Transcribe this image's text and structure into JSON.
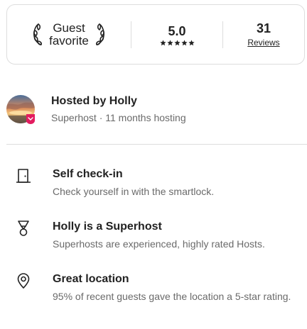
{
  "highlights": {
    "badge": {
      "line1": "Guest",
      "line2": "favorite",
      "icon": "laurel-icon"
    },
    "rating": {
      "value": "5.0",
      "stars": 5,
      "star_icon": "star-icon"
    },
    "reviews": {
      "count": "31",
      "label": "Reviews"
    }
  },
  "host": {
    "title": "Hosted by Holly",
    "subtitle": "Superhost · 11 months hosting",
    "avatar": "host-avatar",
    "badge_color": "#e31c5f"
  },
  "features": [
    {
      "icon": "door-icon",
      "title": "Self check-in",
      "subtitle": "Check yourself in with the smartlock."
    },
    {
      "icon": "medal-icon",
      "title": "Holly is a Superhost",
      "subtitle": "Superhosts are experienced, highly rated Hosts."
    },
    {
      "icon": "location-pin-icon",
      "title": "Great location",
      "subtitle": "95% of recent guests gave the location a 5-star rating."
    }
  ],
  "colors": {
    "text": "#222222",
    "muted": "#6a6a6a",
    "border": "#dddddd",
    "brand": "#e31c5f"
  }
}
